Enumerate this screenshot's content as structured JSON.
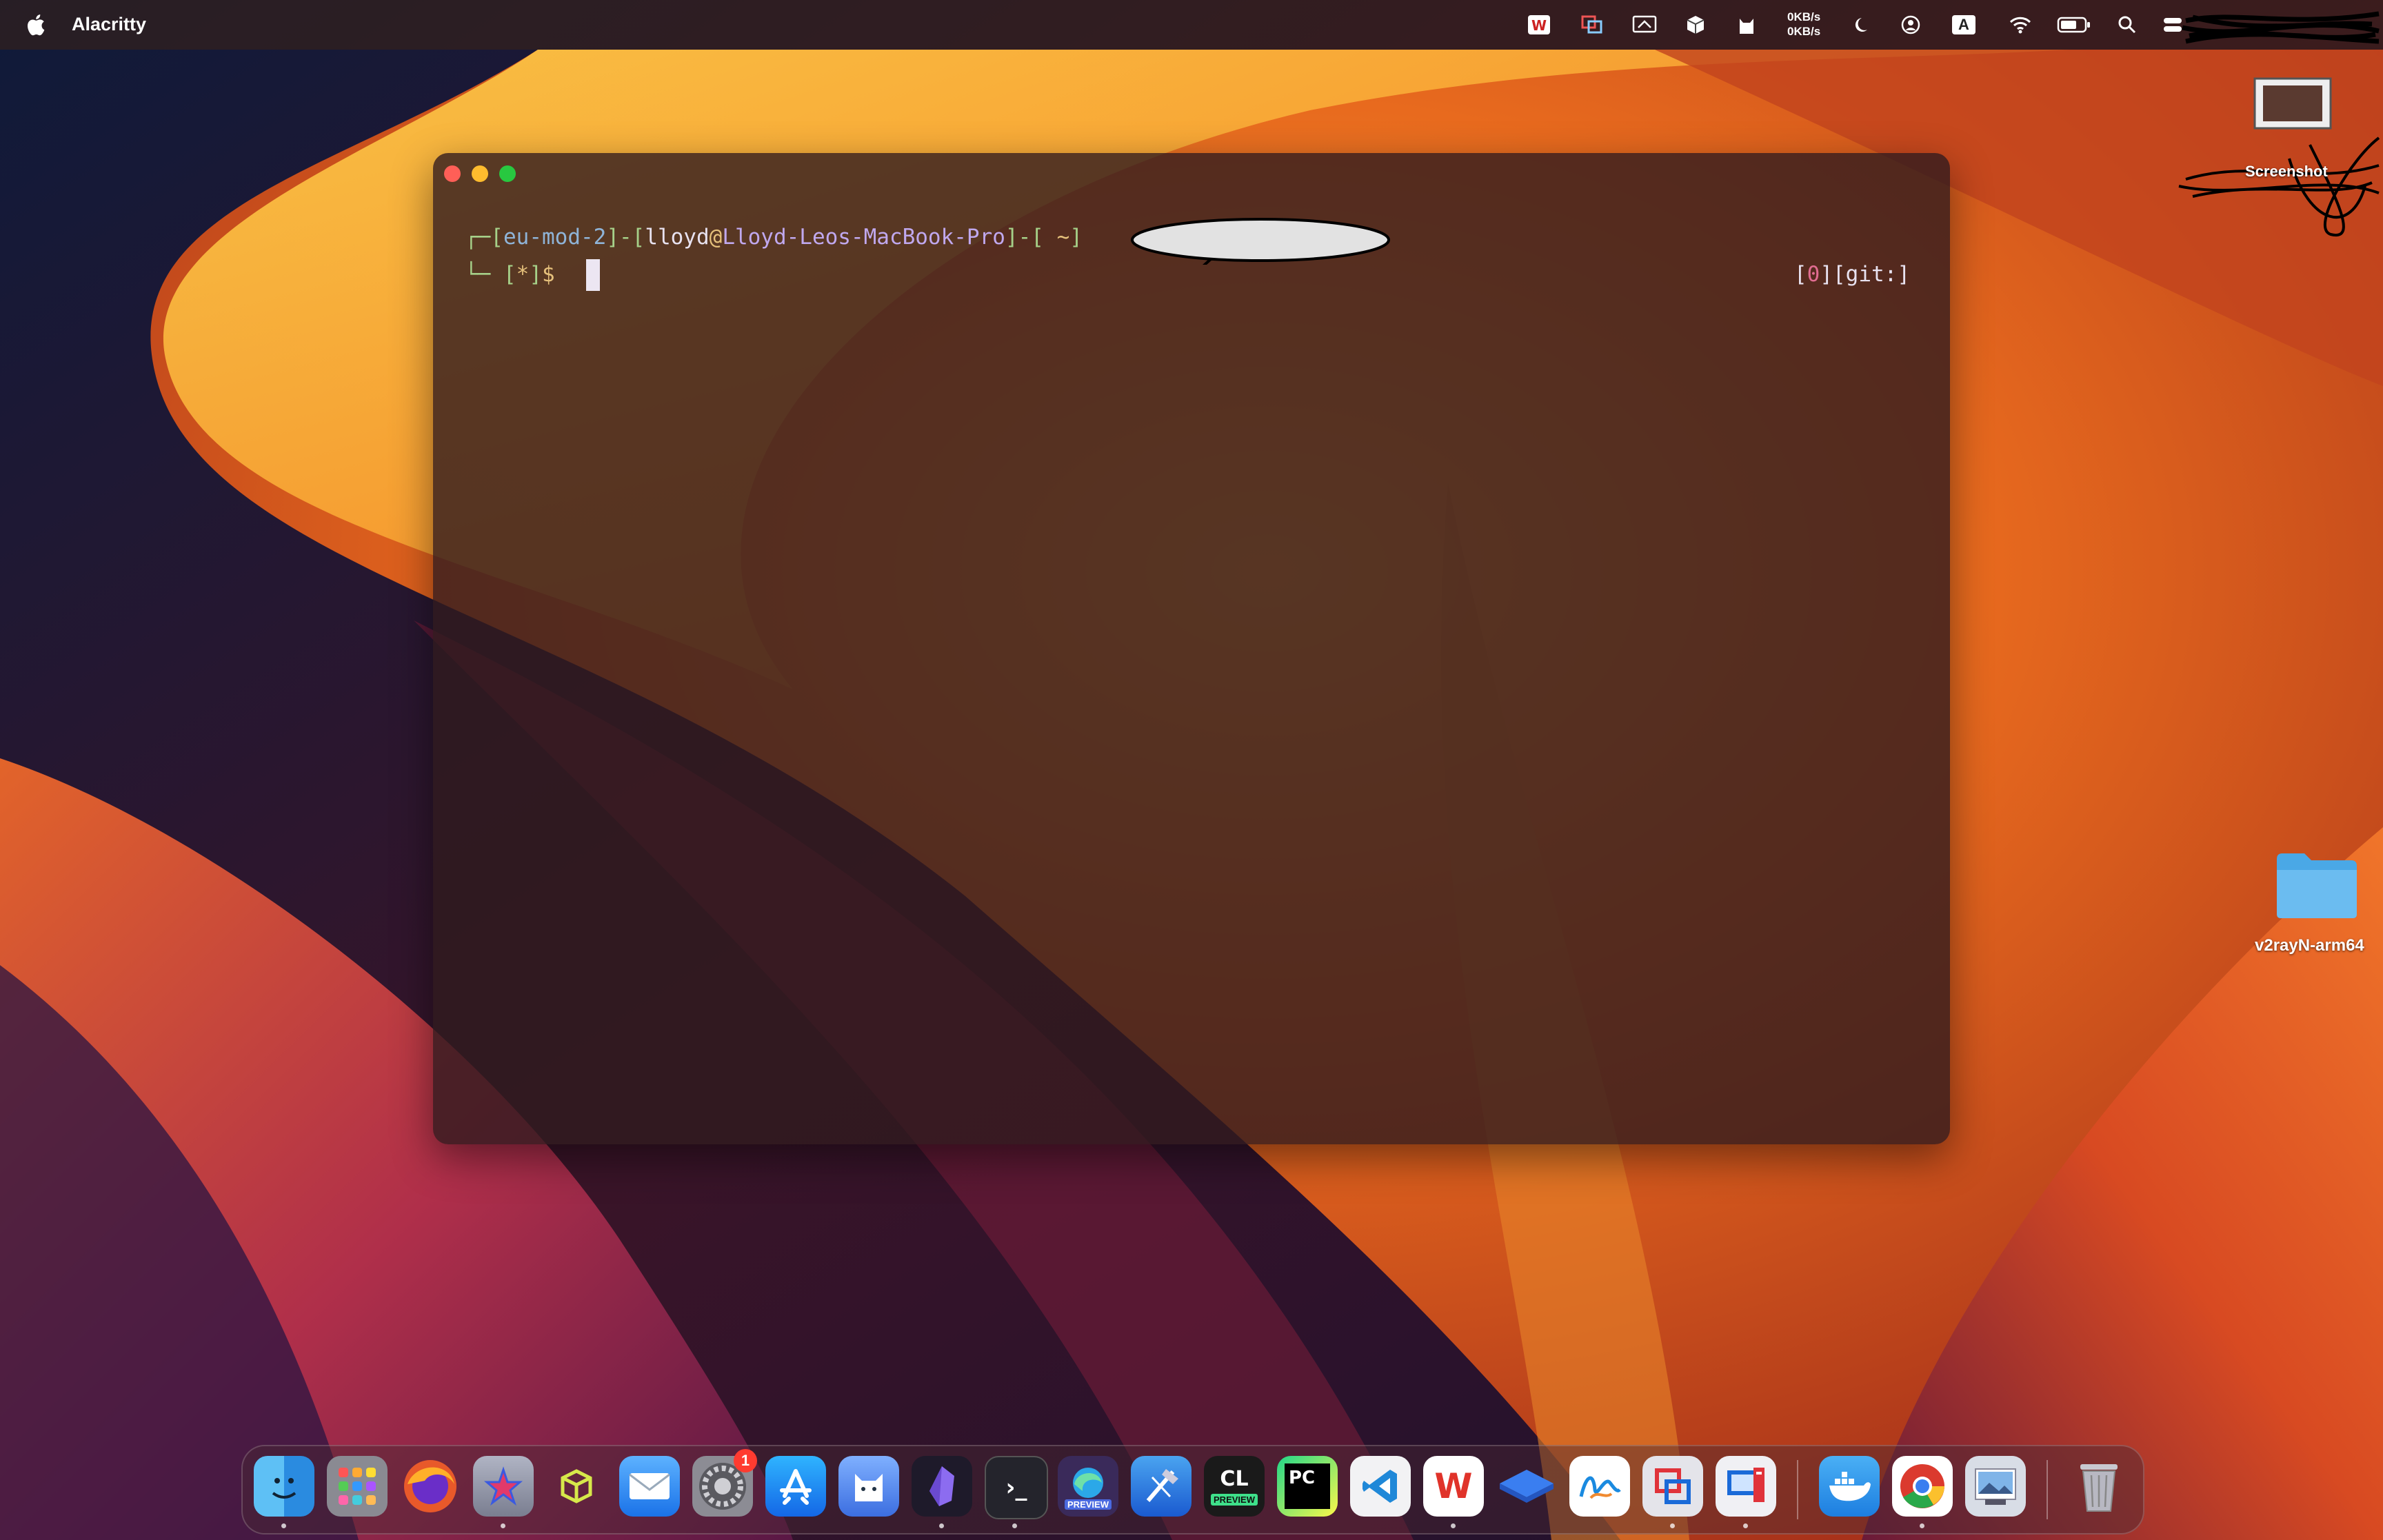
{
  "menubar": {
    "app_name": "Alacritty",
    "net_up": "0KB/s",
    "net_down": "0KB/s",
    "status_icons": [
      "wps-icon",
      "parallels-icon",
      "screen-mirror-icon",
      "cube-icon",
      "cat-icon",
      "moon-icon",
      "user-icon",
      "input-source-icon",
      "wifi-icon",
      "battery-icon",
      "search-icon",
      "control-center-icon"
    ],
    "input_source": "A"
  },
  "terminal": {
    "line1": {
      "open": "┌─[",
      "env": "eu-mod-2",
      "sep1": "]-[",
      "user": "lloyd",
      "at": "@",
      "host": "Lloyd-Leos-MacBook-Pro",
      "sep2": "]-[",
      "path": " ~",
      "close": "]"
    },
    "line2": {
      "corner": "└─",
      "open": " [",
      "star": "*",
      "close": "]",
      "prompt": "$"
    },
    "right_status": {
      "open": "[",
      "code": "0",
      "mid": "][",
      "git": "git:",
      "close": "]"
    }
  },
  "desktop": {
    "screenshot_label": "Screenshot",
    "folder_label": "v2rayN-arm64"
  },
  "dock": {
    "apps": [
      "Finder",
      "Launchpad",
      "Firefox",
      "Pixelmator",
      "Cube",
      "Mail",
      "System Settings",
      "App Store",
      "Cat",
      "Obsidian",
      "Terminal",
      "Edge Preview",
      "Xcode",
      "CLion Preview",
      "PyCharm",
      "VS Code",
      "WPS",
      "Sequel",
      "Freeform",
      "Parallels",
      "Remote Desktop",
      "Docker",
      "Chrome",
      "Preview",
      "Trash"
    ],
    "settings_badge": "1",
    "clion_tag": "PREVIEW",
    "edge_tag": "PREVIEW",
    "pycharm_text": "PC",
    "clion_text": "CL"
  },
  "colors": {
    "accent_green": "#a6d189",
    "accent_yellow": "#e5c07b",
    "accent_purple": "#c0a8ee"
  }
}
